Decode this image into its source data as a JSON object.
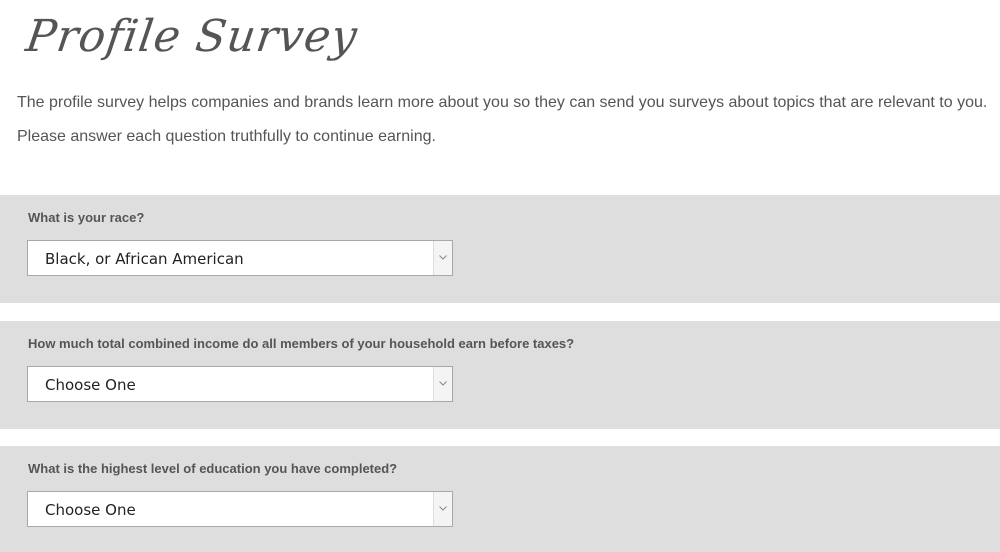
{
  "page": {
    "title": "Profile Survey",
    "intro": "The profile survey helps companies and brands learn more about you so they can send you surveys about topics that are relevant to you. Please answer each question truthfully to continue earning."
  },
  "questions": [
    {
      "label": "What is your race?",
      "selected": "Black, or African American"
    },
    {
      "label": "How much total combined income do all members of your household earn before taxes?",
      "selected": "Choose One"
    },
    {
      "label": "What is the highest level of education you have completed?",
      "selected": "Choose One"
    }
  ],
  "colors": {
    "panel_bg": "#dedede",
    "text": "#555555",
    "select_border": "#a9a9a9"
  },
  "icons": {
    "select_arrow": "chevron-down-icon"
  }
}
